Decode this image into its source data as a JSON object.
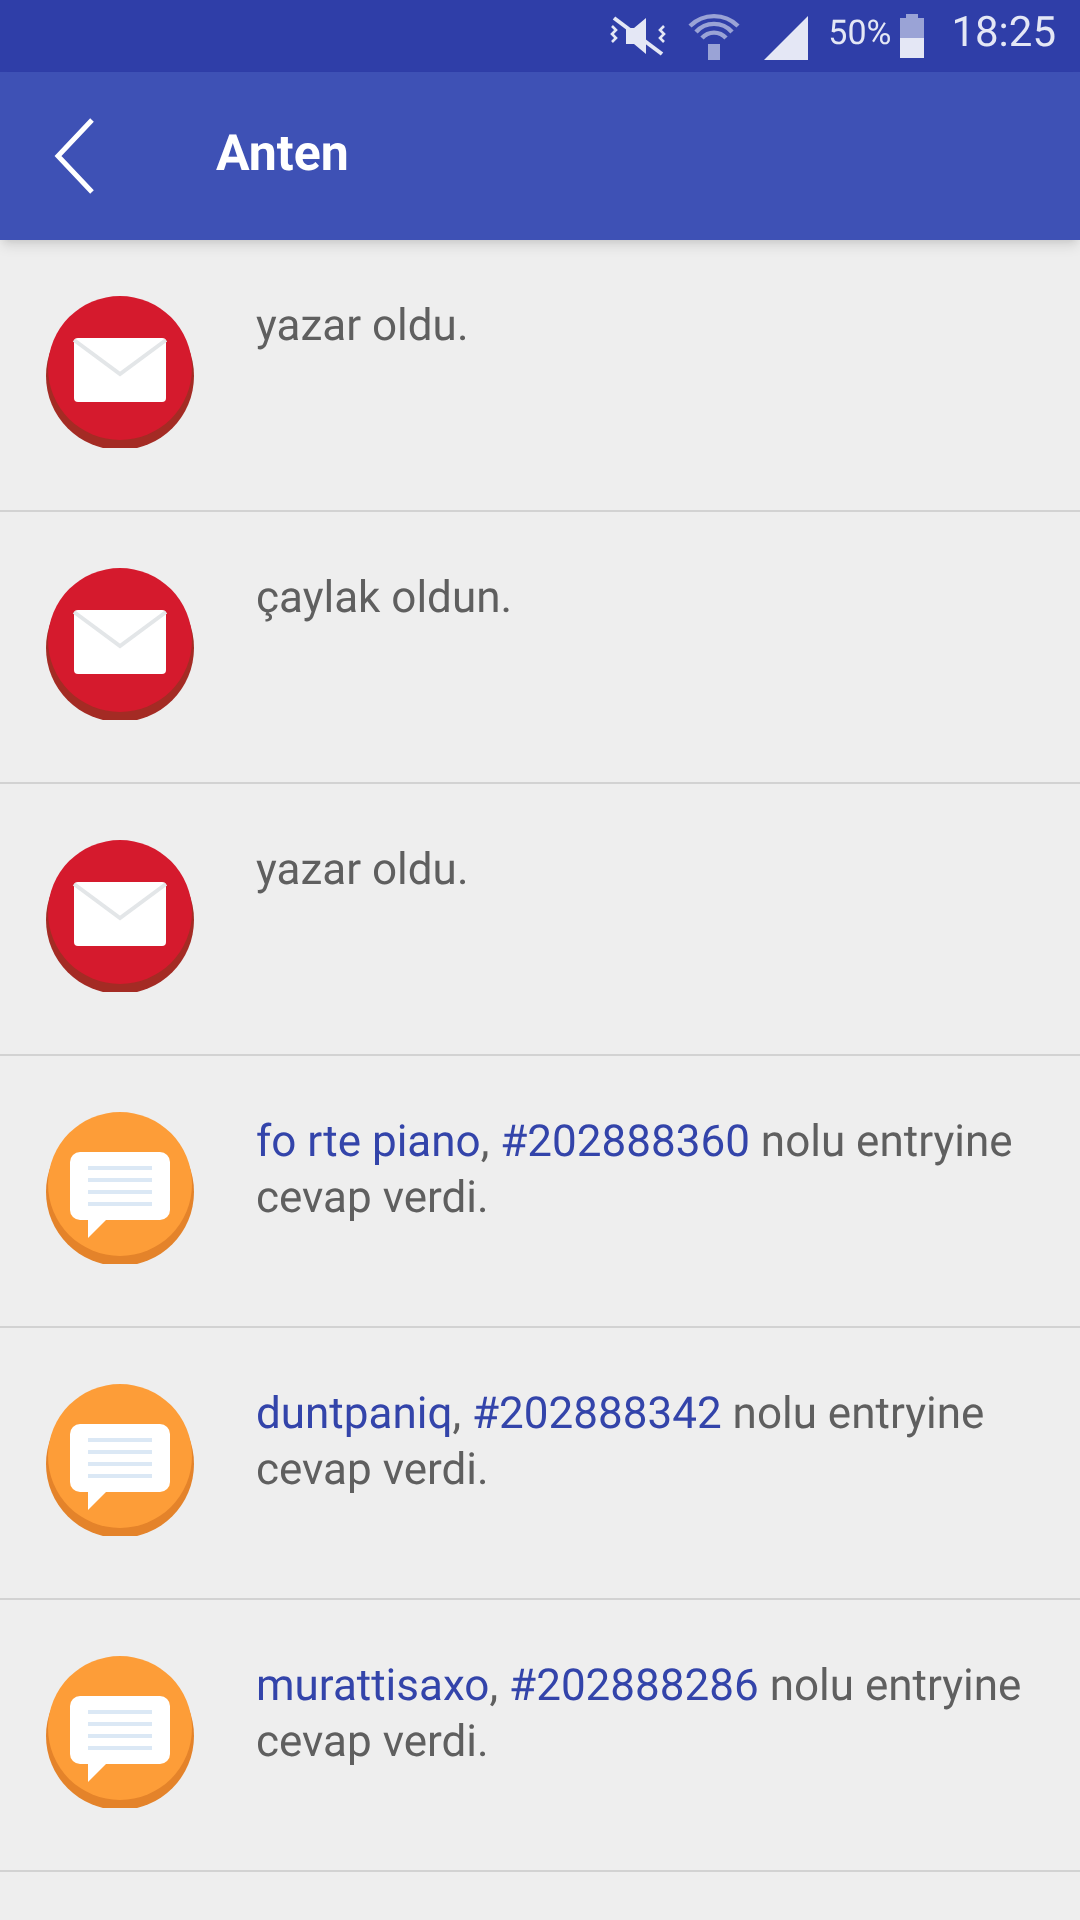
{
  "status_bar": {
    "battery": "50%",
    "time": "18:25"
  },
  "app_bar": {
    "title": "Anten"
  },
  "notifications": [
    {
      "kind": "message",
      "text": "yazar oldu."
    },
    {
      "kind": "message",
      "text": "çaylak oldun."
    },
    {
      "kind": "message",
      "text": "yazar oldu."
    },
    {
      "kind": "reply",
      "user": "fo rte piano",
      "separator": ",",
      "entry": "#202888360",
      "text": "nolu entryine cevap verdi."
    },
    {
      "kind": "reply",
      "user": "duntpaniq",
      "separator": ",",
      "entry": "#202888342",
      "text": "nolu entryine cevap verdi."
    },
    {
      "kind": "reply",
      "user": "murattisaxo",
      "separator": ",",
      "entry": "#202888286",
      "text": "nolu entryine cevap verdi."
    }
  ]
}
